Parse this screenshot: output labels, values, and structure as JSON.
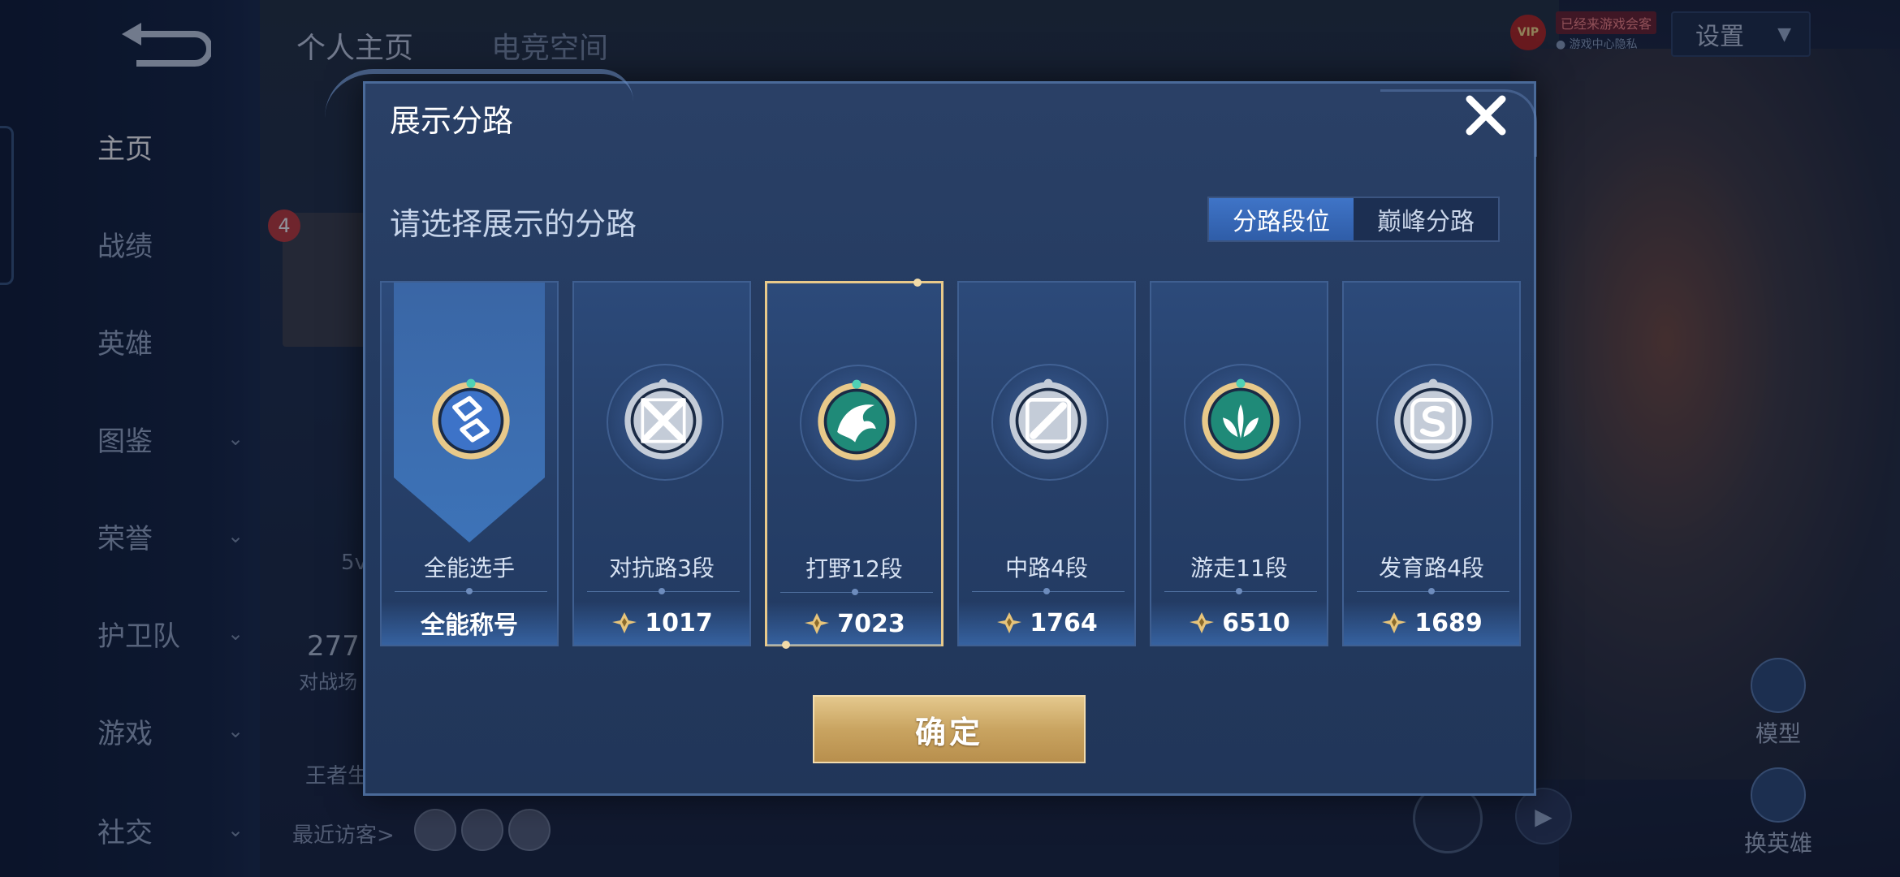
{
  "background": {
    "nav": [
      {
        "label": "主页",
        "active": true,
        "chevron": false
      },
      {
        "label": "战绩",
        "active": false,
        "chevron": false
      },
      {
        "label": "英雄",
        "active": false,
        "chevron": false
      },
      {
        "label": "图鉴",
        "active": false,
        "chevron": true
      },
      {
        "label": "荣誉",
        "active": false,
        "chevron": true
      },
      {
        "label": "护卫队",
        "active": false,
        "chevron": true
      },
      {
        "label": "游戏",
        "active": false,
        "chevron": true
      },
      {
        "label": "社交",
        "active": false,
        "chevron": true
      }
    ],
    "tabs": [
      "个人主页",
      "电竞空间"
    ],
    "settings_label": "设置",
    "vip_label": "VIP",
    "vip_line1": "已经来游戏会客",
    "vip_line2": "● 游戏中心隐私",
    "avatar_badge": "4",
    "stat_partial": "5v",
    "count_partial": "277",
    "count_label_partial": "对战场",
    "rank_label_partial": "王者生",
    "visitors_label": "最近访客>",
    "model_label": "模型",
    "swap_label": "换英雄"
  },
  "dialog": {
    "title": "展示分路",
    "subtitle": "请选择展示的分路",
    "segments": [
      {
        "label": "分路段位",
        "active": true
      },
      {
        "label": "巅峰分路",
        "active": false
      }
    ],
    "cards": [
      {
        "name": "全能选手",
        "score": "全能称号",
        "score_icon": false,
        "emblem": "all-round-emblem-icon",
        "rim": "gold",
        "core": "blue",
        "banner": true,
        "selected": false
      },
      {
        "name": "对抗路3段",
        "score": "1017",
        "score_icon": true,
        "emblem": "clash-lane-emblem-icon",
        "rim": "silver",
        "core": "silver",
        "banner": false,
        "selected": false
      },
      {
        "name": "打野12段",
        "score": "7023",
        "score_icon": true,
        "emblem": "jungle-emblem-icon",
        "rim": "gold",
        "core": "teal",
        "banner": false,
        "selected": true
      },
      {
        "name": "中路4段",
        "score": "1764",
        "score_icon": true,
        "emblem": "mid-lane-emblem-icon",
        "rim": "silver",
        "core": "silver",
        "banner": false,
        "selected": false
      },
      {
        "name": "游走11段",
        "score": "6510",
        "score_icon": true,
        "emblem": "roam-emblem-icon",
        "rim": "gold",
        "core": "teal",
        "banner": false,
        "selected": false
      },
      {
        "name": "发育路4段",
        "score": "1689",
        "score_icon": true,
        "emblem": "farm-lane-emblem-icon",
        "rim": "silver",
        "core": "silver",
        "banner": false,
        "selected": false
      }
    ],
    "confirm_label": "确定"
  },
  "colors": {
    "gold": "#e8c98a",
    "silver": "#c4ccd8",
    "teal": "#1f8a78",
    "blue": "#3d73c8",
    "accent": "#3f74c7"
  }
}
